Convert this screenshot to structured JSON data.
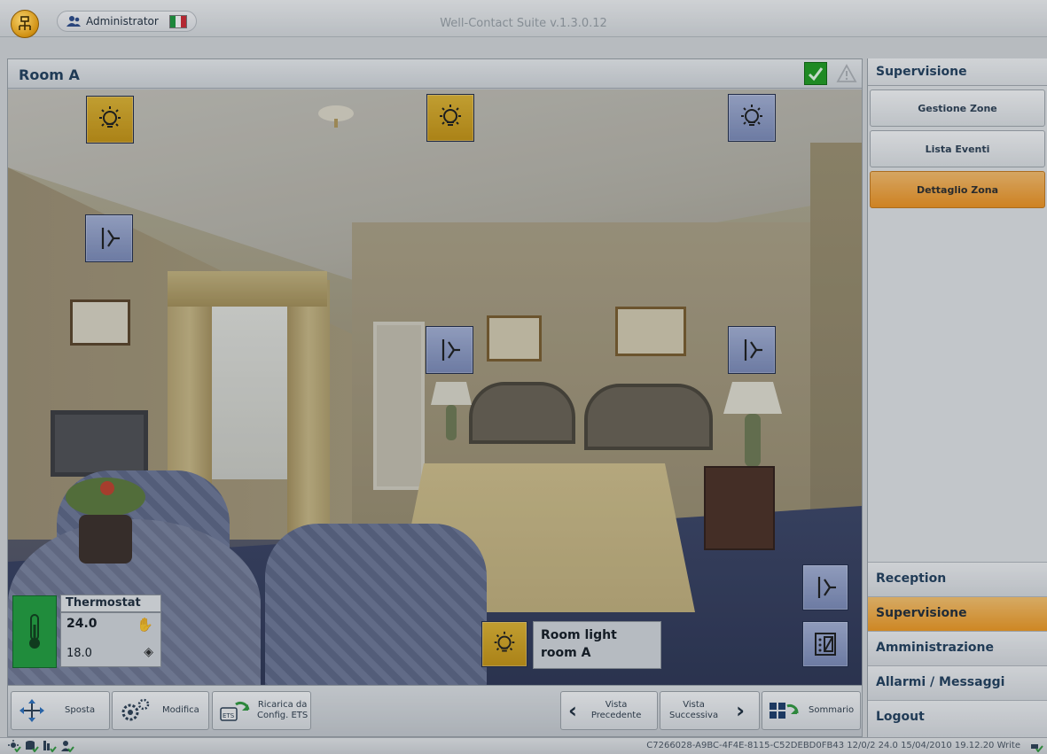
{
  "app": {
    "title": "Well-Contact Suite v.1.3.0.12",
    "user": "Administrator"
  },
  "room": {
    "title": "Room A"
  },
  "thermostat": {
    "title": "Thermostat",
    "setpoint": "24.0",
    "measured": "18.0"
  },
  "room_light": {
    "line1": "Room light",
    "line2": "room A"
  },
  "toolbar": {
    "move": "Sposta",
    "edit": "Modifica",
    "reload_line1": "Ricarica da",
    "reload_line2": "Config. ETS",
    "prev_line1": "Vista",
    "prev_line2": "Precedente",
    "next_line1": "Vista",
    "next_line2": "Successiva",
    "summary": "Sommario"
  },
  "sidebar": {
    "header": "Supervisione",
    "buttons": [
      {
        "label": "Gestione Zone",
        "active": false
      },
      {
        "label": "Lista Eventi",
        "active": false
      },
      {
        "label": "Dettaglio Zona",
        "active": true
      }
    ],
    "nav": [
      {
        "label": "Reception",
        "active": false
      },
      {
        "label": "Supervisione",
        "active": true
      },
      {
        "label": "Amministrazione",
        "active": false
      },
      {
        "label": "Allarmi / Messaggi",
        "active": false
      },
      {
        "label": "Logout",
        "active": false
      }
    ]
  },
  "status": {
    "text": "C7266028-A9BC-4F4E-8115-C52DEBD0FB43 12/0/2 24.0 15/04/2010 19.12.20 Write"
  },
  "colors": {
    "accent_orange": "#f39a1f",
    "device_on": "#d4a21f",
    "device_off": "#8a98c4",
    "thermo_green": "#1fa03c"
  }
}
